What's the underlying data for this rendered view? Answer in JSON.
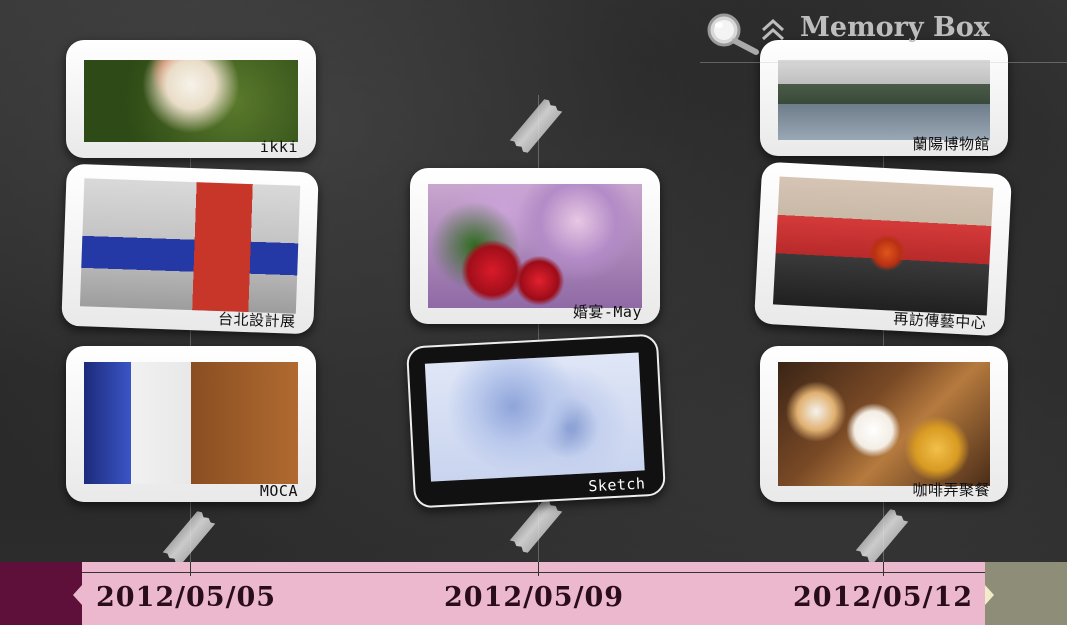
{
  "header": {
    "title": "Memory Box",
    "search_icon": "magnifier-icon",
    "collapse_icon": "chevron-double-up-icon"
  },
  "columns": [
    {
      "date": "2012/05/05",
      "cards": [
        {
          "caption": "ikki"
        },
        {
          "caption": "台北設計展"
        },
        {
          "caption": "MOCA"
        }
      ]
    },
    {
      "date": "2012/05/09",
      "cards": [
        {
          "caption": "婚宴-May"
        },
        {
          "caption": "Sketch"
        }
      ]
    },
    {
      "date": "2012/05/12",
      "cards": [
        {
          "caption": "蘭陽博物館"
        },
        {
          "caption": "再訪傳藝中心"
        },
        {
          "caption": "咖啡弄聚餐"
        }
      ]
    }
  ],
  "colors": {
    "timeline_left": "#5e0f3a",
    "timeline_main": "#ecb8cd",
    "timeline_right": "#8e8d78",
    "date_text": "#2a0d1a",
    "title_text": "#bdbdbd"
  }
}
